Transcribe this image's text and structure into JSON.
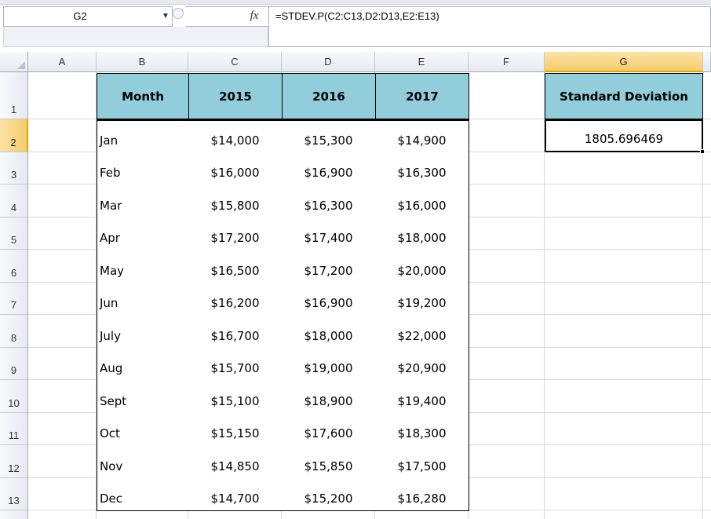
{
  "formula_bar": {
    "name_box": "G2",
    "fx_label": "fx",
    "formula": "=STDEV.P(C2:C13,D2:D13,E2:E13)"
  },
  "columns": [
    "A",
    "B",
    "C",
    "D",
    "E",
    "F",
    "G"
  ],
  "selected_column": "G",
  "rows": [
    "1",
    "2",
    "3",
    "4",
    "5",
    "6",
    "7",
    "8",
    "9",
    "10",
    "11",
    "12",
    "13"
  ],
  "selected_row": "2",
  "table": {
    "headers": [
      "Month",
      "2015",
      "2016",
      "2017"
    ],
    "rows": [
      [
        "Jan",
        "$14,000",
        "$15,300",
        "$14,900"
      ],
      [
        "Feb",
        "$16,000",
        "$16,900",
        "$16,300"
      ],
      [
        "Mar",
        "$15,800",
        "$16,300",
        "$16,000"
      ],
      [
        "Apr",
        "$17,200",
        "$17,400",
        "$18,000"
      ],
      [
        "May",
        "$16,500",
        "$17,200",
        "$20,000"
      ],
      [
        "Jun",
        "$16,200",
        "$16,900",
        "$19,200"
      ],
      [
        "July",
        "$16,700",
        "$18,000",
        "$22,000"
      ],
      [
        "Aug",
        "$15,700",
        "$19,000",
        "$20,900"
      ],
      [
        "Sept",
        "$15,100",
        "$18,900",
        "$19,400"
      ],
      [
        "Oct",
        "$15,150",
        "$17,600",
        "$18,300"
      ],
      [
        "Nov",
        "$14,850",
        "$15,850",
        "$17,500"
      ],
      [
        "Dec",
        "$14,700",
        "$15,200",
        "$16,280"
      ]
    ]
  },
  "result": {
    "header": "Standard Deviation",
    "value": "1805.696469"
  },
  "colors": {
    "header_fill": "#92cddc",
    "selected_header": "#f6cc6e"
  }
}
